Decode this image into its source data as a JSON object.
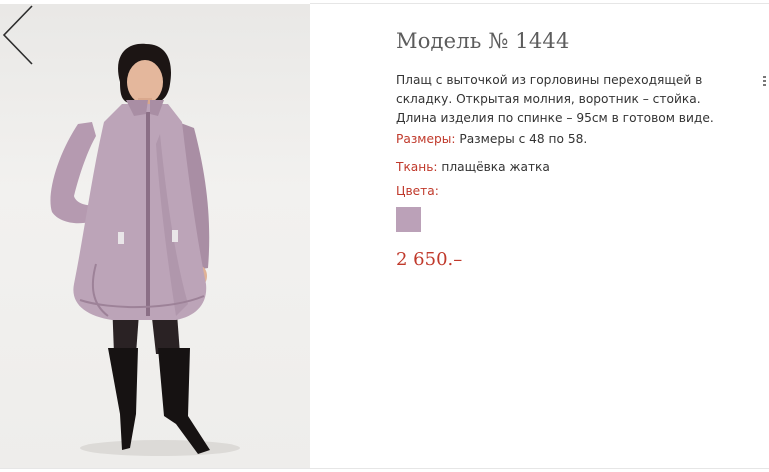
{
  "product": {
    "title": "Модель № 1444",
    "description": "Плащ с выточкой из горловины переходящей в складку. Открытая молния, воротник – стойка. Длина изделия по спинке – 95см    в готовом виде.",
    "sizes_label": "Размеры:",
    "sizes_value": " Размеры с 48 по 58.",
    "fabric_label": "Ткань:",
    "fabric_value": " плащёвка жатка",
    "colors_label": "Цвета:",
    "price": "2 650.–"
  },
  "colors": {
    "accent": "#c0392b",
    "swatch": "#bba1b8",
    "title": "#5c5c5c"
  },
  "icons": {
    "prev": "chevron-left-icon"
  }
}
